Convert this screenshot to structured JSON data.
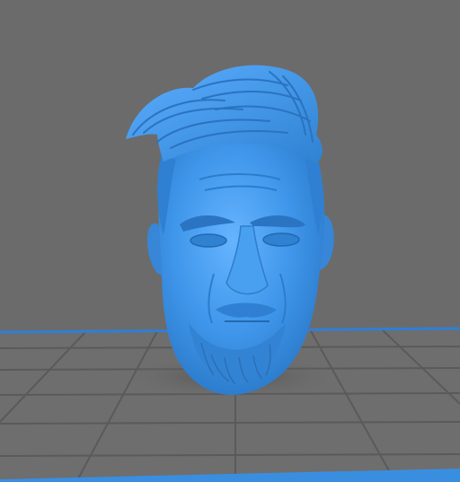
{
  "viewport": {
    "background_color": "#6b6b6b",
    "bed_color": "#6e6e6e",
    "grid_color": "#5a5a5a",
    "bed_edge_color": "#2f7fd6",
    "model_color": "#3f96ea",
    "model_shadow_color": "#595959",
    "model_name": "sculpted-head-model"
  }
}
